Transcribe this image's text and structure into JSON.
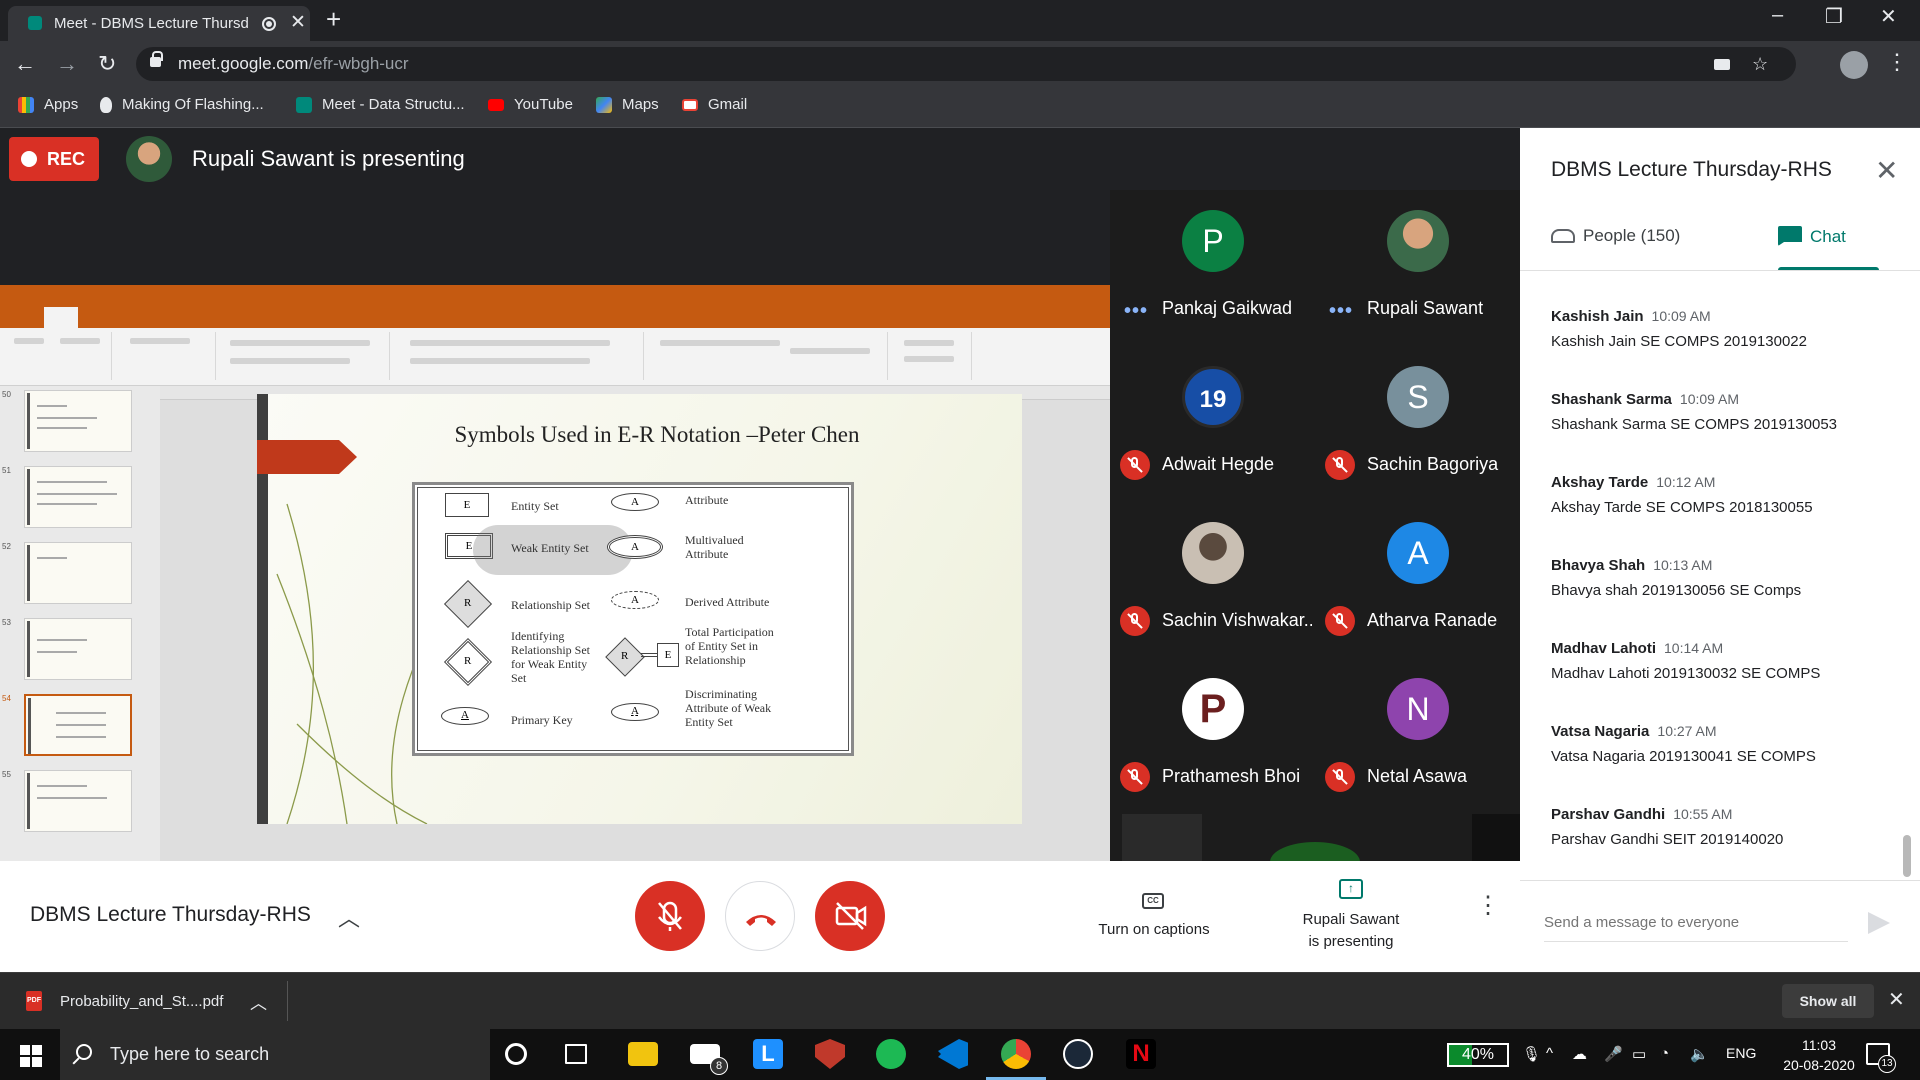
{
  "browser": {
    "tab_title": "Meet - DBMS Lecture Thursd",
    "url_host": "meet.google.com",
    "url_path": "/efr-wbgh-ucr",
    "bookmarks": [
      "Apps",
      "Making Of Flashing...",
      "Meet - Data Structu...",
      "YouTube",
      "Maps",
      "Gmail"
    ]
  },
  "meet": {
    "rec_label": "REC",
    "presenter_banner": "Rupali Sawant is presenting",
    "meeting_name": "DBMS Lecture Thursday-RHS",
    "captions_label": "Turn on captions",
    "presenting_label_1": "Rupali Sawant",
    "presenting_label_2": "is presenting"
  },
  "slide": {
    "title": "Symbols Used in E-R Notation –Peter Chen",
    "rows": [
      {
        "sym": "E",
        "label": "Entity Set",
        "sym2": "A",
        "label2": "Attribute"
      },
      {
        "sym": "E",
        "label": "Weak Entity Set",
        "sym2": "A",
        "label2": "Multivalued Attribute"
      },
      {
        "sym": "R",
        "label": "Relationship Set",
        "sym2": "A",
        "label2": "Derived Attribute"
      },
      {
        "sym": "R",
        "label": "Identifying Relationship Set for Weak Entity Set",
        "sym2": "R",
        "sym2b": "E",
        "label2": "Total Participation of Entity Set in Relationship"
      },
      {
        "sym": "A",
        "label": "Primary Key",
        "sym2": "A",
        "label2": "Discriminating Attribute of Weak Entity Set"
      }
    ],
    "thumb_numbers": [
      "50",
      "51",
      "52",
      "53",
      "54",
      "55"
    ]
  },
  "participants": [
    {
      "name": "Pankaj Gaikwad",
      "initial": "P",
      "color": "#0b8043",
      "muted": false
    },
    {
      "name": "Rupali Sawant",
      "initial": "",
      "color": "#3b6a4a",
      "muted": false
    },
    {
      "name": "Adwait Hegde",
      "initial": "19",
      "color": "#174ea6",
      "muted": true
    },
    {
      "name": "Sachin Bagoriya",
      "initial": "S",
      "color": "#78909c",
      "muted": true
    },
    {
      "name": "Sachin Vishwakar...",
      "initial": "",
      "color": "#6d5a4a",
      "muted": true
    },
    {
      "name": "Atharva Ranade",
      "initial": "A",
      "color": "#1e88e5",
      "muted": true
    },
    {
      "name": "Prathamesh Bhoi",
      "initial": "P",
      "color": "#ffffff",
      "muted": true
    },
    {
      "name": "Netal Asawa",
      "initial": "N",
      "color": "#8e44ad",
      "muted": true
    }
  ],
  "panel": {
    "title": "DBMS Lecture Thursday-RHS",
    "people_tab": "People (150)",
    "chat_tab": "Chat",
    "send_placeholder": "Send a message to everyone",
    "messages": [
      {
        "who": "Kashish Jain",
        "time": "10:09 AM",
        "text": "Kashish Jain SE COMPS 2019130022"
      },
      {
        "who": "Shashank Sarma",
        "time": "10:09 AM",
        "text": "Shashank Sarma SE COMPS 2019130053"
      },
      {
        "who": "Akshay Tarde",
        "time": "10:12 AM",
        "text": "Akshay Tarde SE COMPS 2018130055"
      },
      {
        "who": "Bhavya Shah",
        "time": "10:13 AM",
        "text": "Bhavya shah 2019130056 SE Comps"
      },
      {
        "who": "Madhav Lahoti",
        "time": "10:14 AM",
        "text": "Madhav Lahoti 2019130032 SE COMPS"
      },
      {
        "who": "Vatsa Nagaria",
        "time": "10:27 AM",
        "text": "Vatsa Nagaria 2019130041 SE COMPS"
      },
      {
        "who": "Parshav Gandhi",
        "time": "10:55 AM",
        "text": "Parshav Gandhi SEIT 2019140020"
      }
    ]
  },
  "downloads": {
    "file_name": "Probability_and_St....pdf",
    "show_all": "Show all"
  },
  "taskbar": {
    "search_placeholder": "Type here to search",
    "mail_badge": "8",
    "battery": "40%",
    "language": "ENG",
    "time": "11:03",
    "date": "20-08-2020",
    "notifications": "13"
  }
}
